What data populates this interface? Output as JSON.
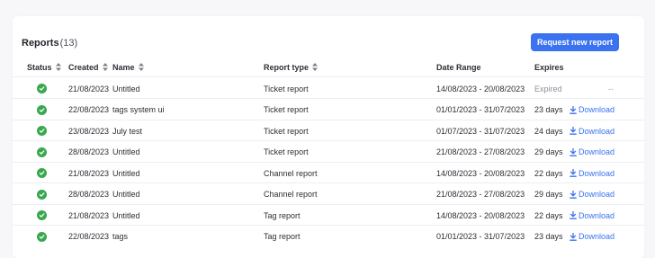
{
  "header": {
    "title": "Reports",
    "count": "(13)",
    "request_button": "Request new report"
  },
  "columns": {
    "status": "Status",
    "created": "Created",
    "name": "Name",
    "report_type": "Report type",
    "date_range": "Date Range",
    "expires": "Expires"
  },
  "colors": {
    "accent": "#3a72f0",
    "success": "#38a84f",
    "muted": "#8d9199"
  },
  "rows": [
    {
      "created": "21/08/2023",
      "name": "Untitled",
      "type": "Ticket report",
      "range": "14/08/2023 - 20/08/2023",
      "expires": "Expired",
      "action": "--"
    },
    {
      "created": "22/08/2023",
      "name": "tags system ui",
      "type": "Ticket report",
      "range": "01/01/2023 - 31/07/2023",
      "expires": "23 days",
      "action": "Download"
    },
    {
      "created": "23/08/2023",
      "name": "July test",
      "type": "Ticket report",
      "range": "01/07/2023 - 31/07/2023",
      "expires": "24 days",
      "action": "Download"
    },
    {
      "created": "28/08/2023",
      "name": "Untitled",
      "type": "Ticket report",
      "range": "21/08/2023 - 27/08/2023",
      "expires": "29 days",
      "action": "Download"
    },
    {
      "created": "21/08/2023",
      "name": "Untitled",
      "type": "Channel report",
      "range": "14/08/2023 - 20/08/2023",
      "expires": "22 days",
      "action": "Download"
    },
    {
      "created": "28/08/2023",
      "name": "Untitled",
      "type": "Channel report",
      "range": "21/08/2023 - 27/08/2023",
      "expires": "29 days",
      "action": "Download"
    },
    {
      "created": "21/08/2023",
      "name": "Untitled",
      "type": "Tag report",
      "range": "14/08/2023 - 20/08/2023",
      "expires": "22 days",
      "action": "Download"
    },
    {
      "created": "22/08/2023",
      "name": "tags",
      "type": "Tag report",
      "range": "01/01/2023 - 31/07/2023",
      "expires": "23 days",
      "action": "Download"
    }
  ]
}
